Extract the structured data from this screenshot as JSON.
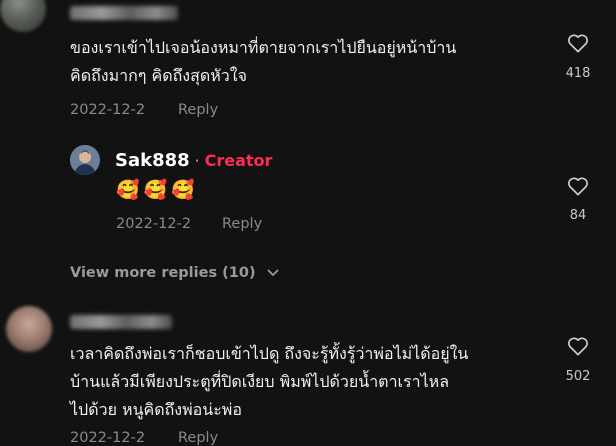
{
  "comments": [
    {
      "text_lines": [
        "ของเราเข้าไปเจอน้องหมาที่ตายจากเราไปยืนอยู่หน้าบ้าน",
        "คิดถึงมากๆ คิดถึงสุดหัวใจ"
      ],
      "date": "2022-12-2",
      "reply_label": "Reply",
      "likes": "418"
    },
    {
      "text_lines": [
        "เวลาคิดถึงพ่อเราก็ชอบเข้าไปดู ถึงจะรู้ทั้งรู้ว่าพ่อไม่ได้อยู่ใน",
        "บ้านแล้วมีเพียงประตูที่ปิดเงียบ พิมพ์ไปด้วยน้ำตาเราไหล",
        "ไปด้วย หนูคิดถึงพ่อน่ะพ่อ"
      ],
      "date": "2022-12-2",
      "reply_label": "Reply",
      "likes": "502"
    }
  ],
  "creator_reply": {
    "username": "Sak888",
    "separator": "·",
    "badge": "Creator",
    "emojis": [
      "🥰",
      "🥰",
      "🥰"
    ],
    "date": "2022-12-2",
    "reply_label": "Reply",
    "likes": "84"
  },
  "view_more": {
    "label": "View more replies (10)",
    "chevron": "⌄"
  },
  "colors": {
    "background": "#121212",
    "creator_accent": "#fe2c55",
    "muted_text": "#8a8a8a"
  }
}
